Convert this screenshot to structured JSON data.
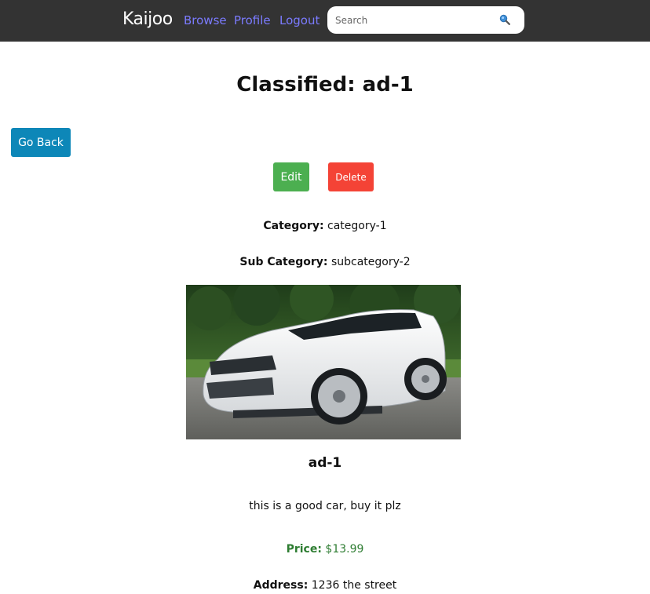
{
  "navbar": {
    "brand": "Kaijoo",
    "links": [
      "Browse",
      "Profile",
      "Logout"
    ],
    "search_placeholder": "Search",
    "search_icon": "magnifier-icon"
  },
  "page": {
    "title": "Classified: ad-1",
    "go_back_label": "Go Back",
    "edit_label": "Edit",
    "delete_label": "Delete"
  },
  "classified": {
    "category_label": "Category:",
    "category": "category-1",
    "subcategory_label": "Sub Category:",
    "subcategory": "subcategory-2",
    "name": "ad-1",
    "description": "this is a good car, buy it plz",
    "price_label": "Price:",
    "price": "$13.99",
    "address_label": "Address:",
    "address": "1236 the street"
  },
  "colors": {
    "navbar_bg": "#333333",
    "nav_link": "#7b7bff",
    "go_back": "#0d87b8",
    "edit": "#4caf50",
    "delete": "#f44336",
    "price": "#2e7d32"
  }
}
